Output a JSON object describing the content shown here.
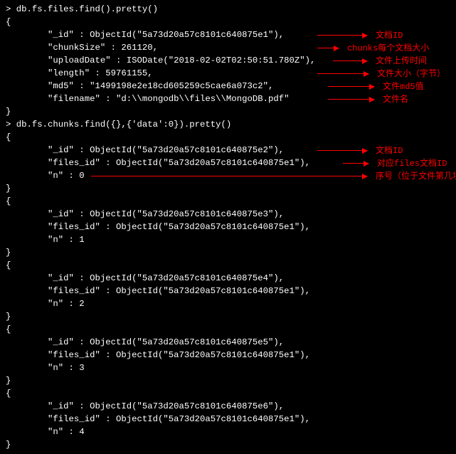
{
  "cmd1": "db.fs.files.find().pretty()",
  "cmd2": "db.fs.chunks.find({},{'data':0}).pretty()",
  "file_doc": {
    "id": "ObjectId(\"5a73d20a57c8101c640875e1\")",
    "chunkSize": "261120",
    "uploadDate": "ISODate(\"2018-02-02T02:50:51.780Z\")",
    "length": "59761155",
    "md5": "\"1499198e2e18cd605259c5cae6a073c2\"",
    "filename": "\"d:\\\\mongodb\\\\files\\\\MongoDB.pdf\""
  },
  "chunks": [
    {
      "id": "ObjectId(\"5a73d20a57c8101c640875e2\")",
      "files_id": "ObjectId(\"5a73d20a57c8101c640875e1\")",
      "n": "0"
    },
    {
      "id": "ObjectId(\"5a73d20a57c8101c640875e3\")",
      "files_id": "ObjectId(\"5a73d20a57c8101c640875e1\")",
      "n": "1"
    },
    {
      "id": "ObjectId(\"5a73d20a57c8101c640875e4\")",
      "files_id": "ObjectId(\"5a73d20a57c8101c640875e1\")",
      "n": "2"
    },
    {
      "id": "ObjectId(\"5a73d20a57c8101c640875e5\")",
      "files_id": "ObjectId(\"5a73d20a57c8101c640875e1\")",
      "n": "3"
    },
    {
      "id": "ObjectId(\"5a73d20a57c8101c640875e6\")",
      "files_id": "ObjectId(\"5a73d20a57c8101c640875e1\")",
      "n": "4"
    }
  ],
  "annots": {
    "a_id": "文档ID",
    "a_chunksize": "chunks每个文档大小",
    "a_upload": "文件上传时间",
    "a_length": "文件大小（字节）",
    "a_md5": "文件md5值",
    "a_filename": "文件名",
    "a_cid": "文档ID",
    "a_filesid": "对应files文档ID",
    "a_n": "序号（位于文件第几块）"
  }
}
